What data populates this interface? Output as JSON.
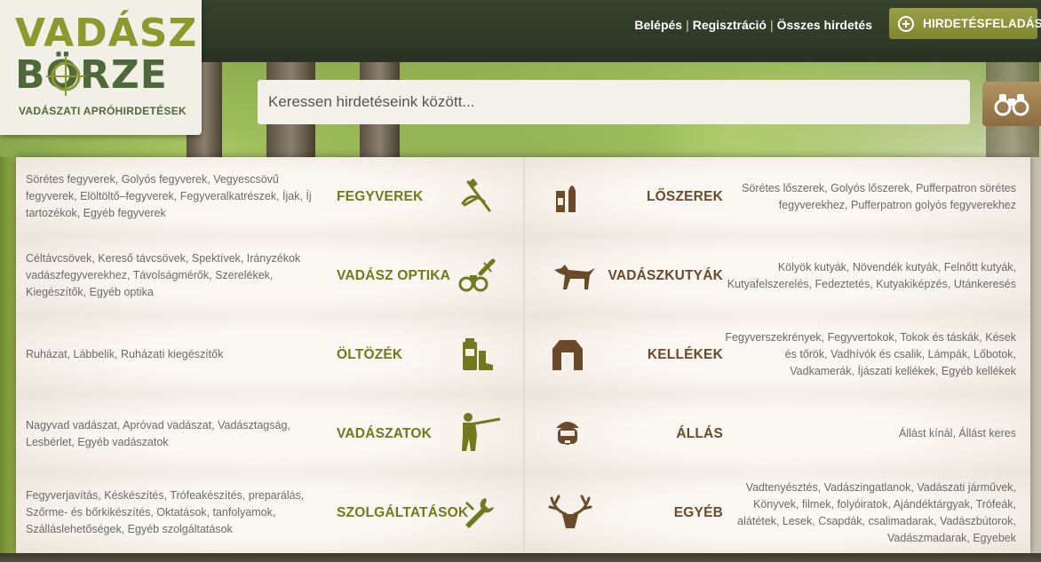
{
  "header": {
    "links": [
      "Belépés",
      "Regisztráció",
      "Összes hirdetés"
    ],
    "separator": "|",
    "post_button": "HIRDETÉSFELADÁS"
  },
  "logo": {
    "line1": "VADÁSZ",
    "line2": "BÖRZE",
    "tagline": "VADÁSZATI APRÓHIRDETÉSEK"
  },
  "search": {
    "placeholder": "Keressen hirdetéseink között..."
  },
  "colors": {
    "green_title": "#6e7a1c",
    "brown_title": "#6b4a2a",
    "icon_green": "#6e7a1c",
    "icon_brown": "#6b4a2a"
  },
  "categories": [
    {
      "left": {
        "title": "FEGYVEREK",
        "icon": "rifle-icon",
        "sub": "Sörétes fegyverek, Golyós fegyverek, Vegyescsövű fegyverek, Elöltöltő–fegyverek, Fegyveralkatrészek, Íjak, Íj tartozékok, Egyéb fegyverek"
      },
      "right": {
        "title": "LŐSZEREK",
        "icon": "ammo-icon",
        "sub": "Sörétes lőszerek, Golyós lőszerek, Pufferpatron sörétes fegyverekhez, Pufferpatron golyós fegyverekhez"
      }
    },
    {
      "left": {
        "title": "VADÁSZ OPTIKA",
        "icon": "binoculars-icon",
        "sub": "Céltávcsövek, Kereső távcsövek, Spektívek, Irányzékok vadászfegyverekhez, Távolságmérők, Szerelékek, Kiegészítők, Egyéb optika"
      },
      "right": {
        "title": "VADÁSZKUTYÁK",
        "icon": "dog-icon",
        "sub": "Kölyök kutyák, Növendék kutyák, Felnőtt kutyák, Kutyafelszerelés, Fedeztetés, Kutyakiképzés, Utánkeresés"
      }
    },
    {
      "left": {
        "title": "ÖLTÖZÉK",
        "icon": "clothing-icon",
        "sub": "Ruházat, Lábbelik, Ruházati kiegészítők"
      },
      "right": {
        "title": "KELLÉKEK",
        "icon": "vest-icon",
        "sub": "Fegyverszekrények, Fegyvertokok, Tokok és táskák, Kések és tőrök, Vadhívók és csalik, Lámpák, Lőbotok, Vadkamerák, Íjászati kellékek, Egyéb kellékek"
      }
    },
    {
      "left": {
        "title": "VADÁSZATOK",
        "icon": "hunter-icon",
        "sub": "Nagyvad vadászat, Apróvad vadászat, Vadásztagság, Lesbérlet, Egyéb vadászatok"
      },
      "right": {
        "title": "ÁLLÁS",
        "icon": "person-icon",
        "sub": "Állást kínál, Állást keres"
      }
    },
    {
      "left": {
        "title": "SZOLGÁLTATÁSOK",
        "icon": "wrench-icon",
        "sub": "Fegyverjavítás, Késkészítés, Trófeakészítés, preparálás, Szőrme- és bőrkikészítés, Oktatások, tanfolyamok, Szálláslehetőségek, Egyéb szolgáltatások"
      },
      "right": {
        "title": "EGYÉB",
        "icon": "deer-icon",
        "sub": "Vadtenyésztés, Vadászingatlanok, Vadászati járművek, Könyvek, filmek, folyóiratok, Ajándéktárgyak, Trófeák, alátétek, Lesek, Csapdák, csalimadarak, Vadászbútorok, Vadászmadarak, Egyebek"
      }
    }
  ]
}
